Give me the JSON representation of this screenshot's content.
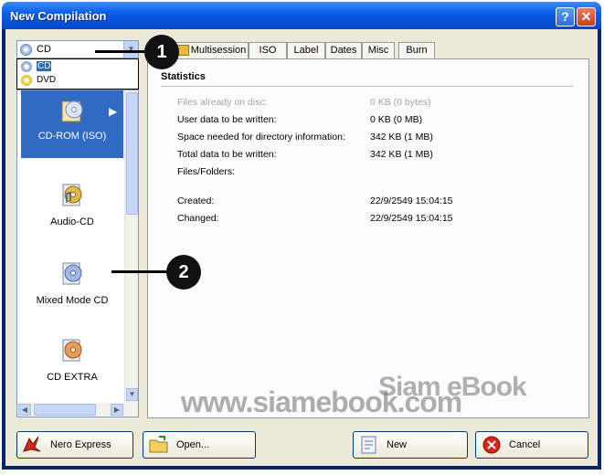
{
  "window": {
    "title": "New Compilation",
    "help_label": "?",
    "close_label": "✕"
  },
  "media_select": {
    "value": "CD",
    "options": [
      "CD",
      "DVD"
    ]
  },
  "compilation_types": [
    {
      "label": "CD-ROM (ISO)",
      "selected": true,
      "icon": "cd-rom-iso-icon"
    },
    {
      "label": "Audio-CD",
      "selected": false,
      "icon": "audio-cd-icon"
    },
    {
      "label": "Mixed Mode CD",
      "selected": false,
      "icon": "mixed-mode-cd-icon"
    },
    {
      "label": "CD EXTRA",
      "selected": false,
      "icon": "cd-extra-icon"
    }
  ],
  "tabs": [
    "Multisession",
    "ISO",
    "Label",
    "Dates",
    "Misc",
    "Burn"
  ],
  "statistics": {
    "title": "Statistics",
    "rows": [
      {
        "label": "Files already on disc:",
        "value": "0 KB (0 bytes)",
        "dim": true
      },
      {
        "label": "User data to be written:",
        "value": "0 KB (0 MB)",
        "dim": false
      },
      {
        "label": "Space needed for directory information:",
        "value": "342 KB (1 MB)",
        "dim": false
      },
      {
        "label": "Total data to be written:",
        "value": "342 KB (1 MB)",
        "dim": false
      },
      {
        "label": "Files/Folders:",
        "value": "",
        "dim": false
      }
    ],
    "created_label": "Created:",
    "created_value": "22/9/2549 15:04:15",
    "changed_label": "Changed:",
    "changed_value": "22/9/2549 15:04:15"
  },
  "buttons": {
    "nero_express": "Nero Express",
    "open": "Open...",
    "new": "New",
    "cancel": "Cancel"
  },
  "callouts": [
    "1",
    "2"
  ],
  "watermark": {
    "line1": "Siam eBook",
    "line2": "www.siamebook.com"
  },
  "colors": {
    "title_bar": "#0a5fe8",
    "selection": "#316ac5",
    "panel": "#ece9d8"
  }
}
